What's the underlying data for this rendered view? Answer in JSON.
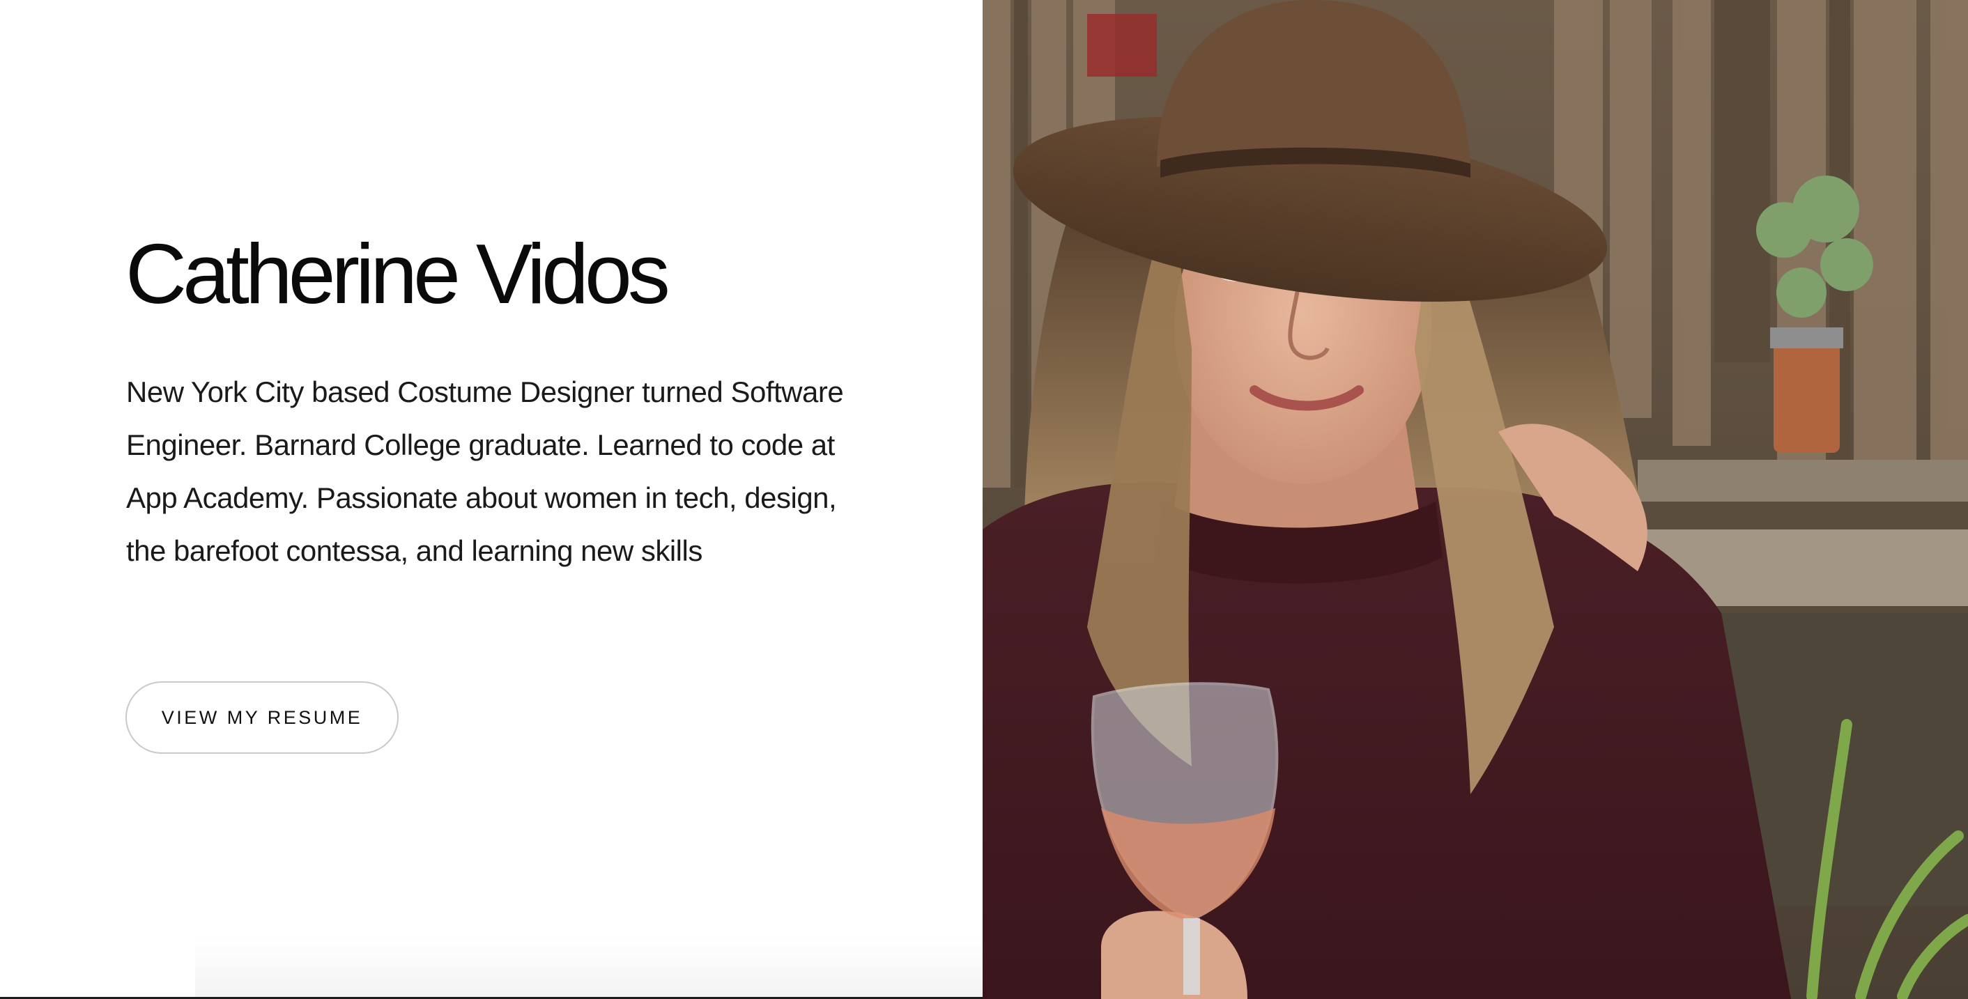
{
  "hero": {
    "name": "Catherine Vidos",
    "bio": "New York City based Costume Designer turned Software Engineer. Barnard College graduate. Learned to code at App Academy. Passionate about women in tech, design, the barefoot contessa, and learning new skills",
    "resume_button_label": "VIEW MY RESUME"
  }
}
